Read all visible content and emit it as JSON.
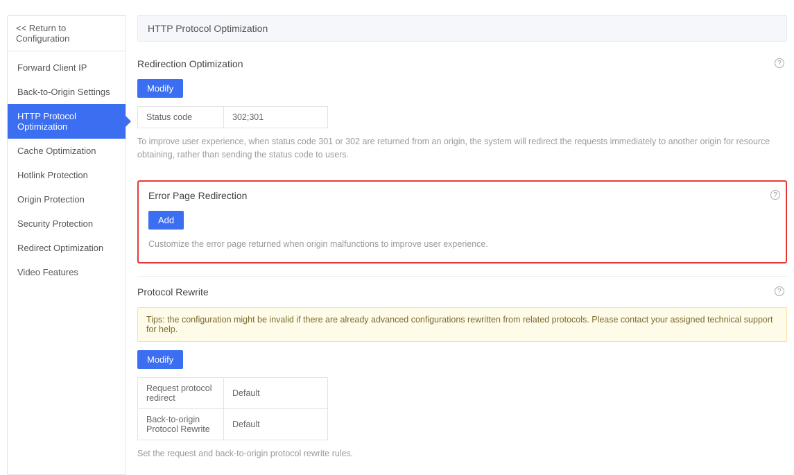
{
  "sidebar": {
    "return_label": "<<  Return to Configuration",
    "items": [
      {
        "label": "Forward Client IP"
      },
      {
        "label": "Back-to-Origin Settings"
      },
      {
        "label": "HTTP Protocol Optimization"
      },
      {
        "label": "Cache Optimization"
      },
      {
        "label": "Hotlink Protection"
      },
      {
        "label": "Origin Protection"
      },
      {
        "label": "Security Protection"
      },
      {
        "label": "Redirect Optimization"
      },
      {
        "label": "Video Features"
      }
    ],
    "active_index": 2
  },
  "page": {
    "title": "HTTP Protocol Optimization"
  },
  "redirection": {
    "title": "Redirection Optimization",
    "modify_label": "Modify",
    "status_code_key": "Status code",
    "status_code_val": "302;301",
    "desc": "To improve user experience, when status code 301 or 302 are returned from an origin, the system will redirect the requests immediately to another origin for resource obtaining, rather than sending the status code to users."
  },
  "error_page": {
    "title": "Error Page Redirection",
    "add_label": "Add",
    "desc": "Customize the error page returned when origin malfunctions to improve user experience."
  },
  "protocol_rewrite": {
    "title": "Protocol Rewrite",
    "tips": "Tips: the configuration might be invalid if there are already advanced configurations rewritten from related protocols. Please contact your assigned technical support for help.",
    "modify_label": "Modify",
    "rows": [
      {
        "key": "Request protocol redirect",
        "val": "Default"
      },
      {
        "key": "Back-to-origin Protocol Rewrite",
        "val": "Default"
      }
    ],
    "desc": "Set the request and back-to-origin protocol rewrite rules."
  },
  "help_glyph": "?"
}
